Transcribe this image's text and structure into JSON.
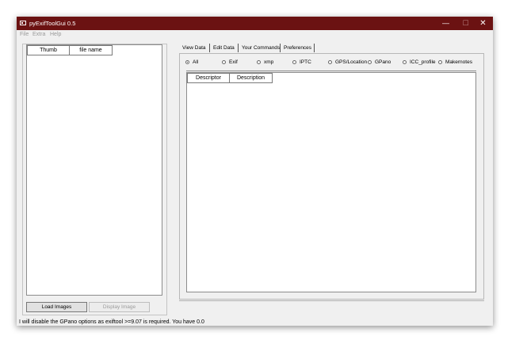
{
  "window": {
    "title": "pyExifToolGui 0.5"
  },
  "window_controls": {
    "minimize": "—",
    "maximize": "☐",
    "close": "✕"
  },
  "menu": {
    "file": "File",
    "extra": "Extra",
    "help": "Help"
  },
  "file_list": {
    "columns": [
      "Thumb",
      "file name"
    ]
  },
  "buttons": {
    "load_images": "Load Images",
    "display_image": "Display Image"
  },
  "tabs": [
    "View Data",
    "Edit Data",
    "Your Commands",
    "Preferences"
  ],
  "view_data": {
    "filters": [
      "All",
      "Exif",
      "xmp",
      "IPTC",
      "GPS/Location",
      "GPano",
      "ICC_profile",
      "Makernotes"
    ],
    "selected_filter": "All",
    "columns": [
      "Descriptor",
      "Description"
    ]
  },
  "status": "I will disable the GPano options as exiftool >=9.07 is required. You have 0.0"
}
